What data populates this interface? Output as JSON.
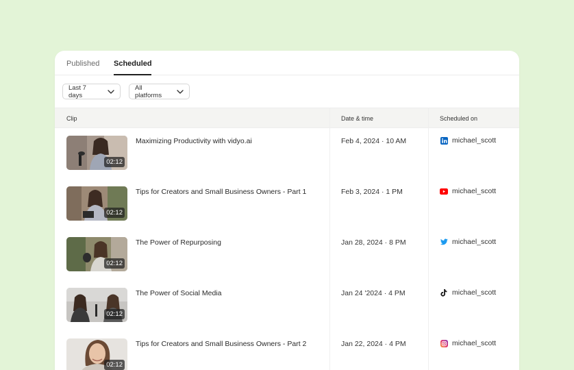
{
  "tabs": {
    "published": "Published",
    "scheduled": "Scheduled"
  },
  "filters": {
    "date_range": "Last 7 days",
    "platform": "All platforms"
  },
  "table": {
    "headers": {
      "clip": "Clip",
      "datetime": "Date & time",
      "scheduled_on": "Scheduled on"
    },
    "rows": [
      {
        "title": "Maximizing Productivity with vidyo.ai",
        "duration": "02:12",
        "date": "Feb 4, 2024",
        "time": "10 AM",
        "platform_icon": "linkedin-icon",
        "account": "michael_scott"
      },
      {
        "title": "Tips for Creators and Small Business Owners - Part 1",
        "duration": "02:12",
        "date": "Feb 3, 2024",
        "time": "1 PM",
        "platform_icon": "youtube-icon",
        "account": "michael_scott"
      },
      {
        "title": "The Power of Repurposing",
        "duration": "02:12",
        "date": "Jan 28, 2024",
        "time": "8 PM",
        "platform_icon": "twitter-icon",
        "account": "michael_scott"
      },
      {
        "title": "The Power of Social Media",
        "duration": "02:12",
        "date": "Jan 24 '2024",
        "time": "4 PM",
        "platform_icon": "tiktok-icon",
        "account": "michael_scott"
      },
      {
        "title": "Tips for Creators and Small Business Owners - Part 2",
        "duration": "02:12",
        "date": "Jan 22, 2024",
        "time": "4 PM",
        "platform_icon": "instagram-icon",
        "account": "michael_scott"
      }
    ]
  },
  "colors": {
    "page_bg": "#e3f4d7",
    "linkedin": "#0a66c2",
    "youtube": "#ff0000",
    "twitter": "#1d9bf0",
    "tiktok": "#111111",
    "instagram": "#e1306c"
  }
}
